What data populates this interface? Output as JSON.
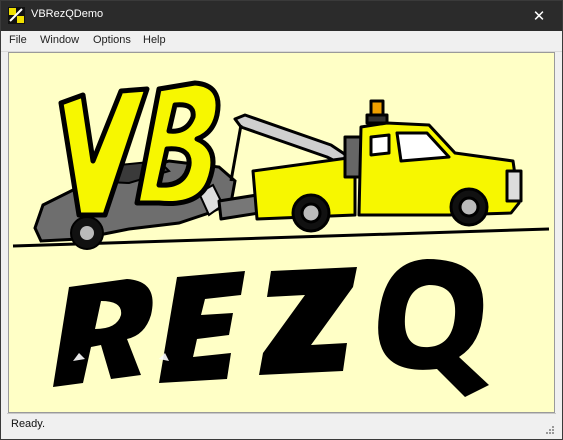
{
  "window": {
    "title": "VBRezQDemo",
    "close_glyph": "✕"
  },
  "menu": {
    "items": [
      "File",
      "Window",
      "Options",
      "Help"
    ]
  },
  "logo": {
    "text": "VB REZQ",
    "icon": "tow-truck-logo"
  },
  "status": {
    "text": "Ready."
  },
  "colors": {
    "titlebar": "#2b2b2b",
    "canvas": "#ffffc6",
    "logo_yellow": "#f7f700"
  }
}
